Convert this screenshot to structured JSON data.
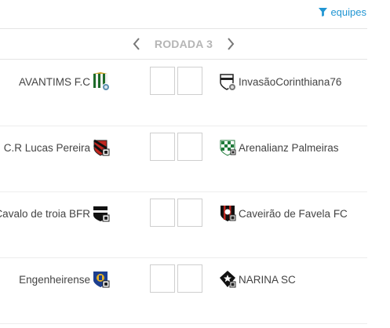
{
  "filter": {
    "label": "equipes",
    "icon": "filter-icon"
  },
  "round": {
    "label": "RODADA 3",
    "prev_icon": "chevron-left-icon",
    "next_icon": "chevron-right-icon"
  },
  "matches": [
    {
      "home": "AVANTIMS F.C",
      "away": "InvasãoCorinthiana76",
      "home_score": "",
      "away_score": ""
    },
    {
      "home": "C.R Lucas Pereira",
      "away": "Arenalianz Palmeiras",
      "home_score": "",
      "away_score": ""
    },
    {
      "home": "Cavalo de troia BFR",
      "away": "Caveirão de Favela FC",
      "home_score": "",
      "away_score": ""
    },
    {
      "home": "Engenheirense",
      "away": "NARINA SC",
      "home_score": "",
      "away_score": ""
    }
  ]
}
